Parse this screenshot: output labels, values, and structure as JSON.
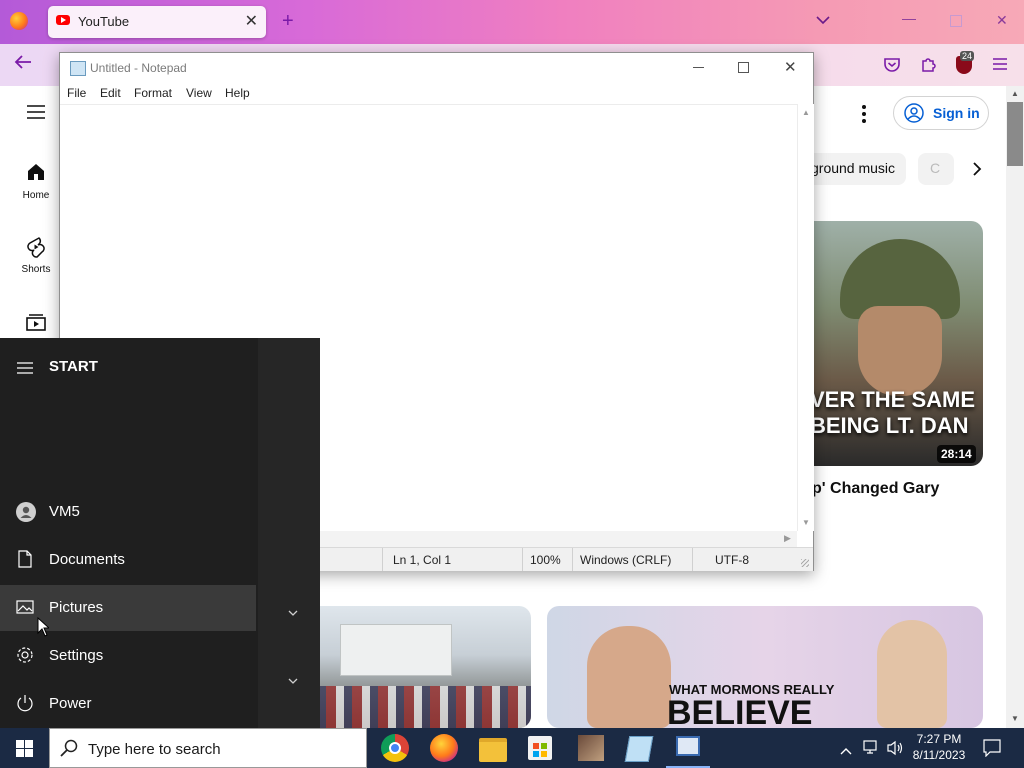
{
  "browser": {
    "tab_title": "YouTube",
    "tab_close": "✕",
    "new_tab": "+",
    "extension_badge": "24"
  },
  "youtube": {
    "guide": [
      {
        "label": "Home",
        "icon": "home-icon"
      },
      {
        "label": "Shorts",
        "icon": "shorts-icon"
      },
      {
        "label": "",
        "icon": "subscriptions-icon"
      }
    ],
    "sign_in": "Sign in",
    "chips": [
      "ground music",
      "C"
    ],
    "videos": [
      {
        "overlay_line1": "VER THE SAME",
        "overlay_line2": "BEING LT. DAN",
        "duration": "28:14",
        "title": "p' Changed Gary"
      },
      {
        "overlay_line1": "WHAT MORMONS REALLY",
        "overlay_line2": "BELIEVE"
      }
    ]
  },
  "notepad": {
    "title": "Untitled - Notepad",
    "menu": [
      "File",
      "Edit",
      "Format",
      "View",
      "Help"
    ],
    "content": "",
    "status": {
      "position": "Ln 1, Col 1",
      "zoom": "100%",
      "line_ending": "Windows (CRLF)",
      "encoding": "UTF-8"
    }
  },
  "start_menu": {
    "header": "START",
    "items": [
      {
        "label": "VM5",
        "icon": "user-icon"
      },
      {
        "label": "Documents",
        "icon": "document-icon"
      },
      {
        "label": "Pictures",
        "icon": "pictures-icon"
      },
      {
        "label": "Settings",
        "icon": "settings-icon"
      },
      {
        "label": "Power",
        "icon": "power-icon"
      }
    ]
  },
  "taskbar": {
    "search_placeholder": "Type here to search",
    "apps": [
      "chrome-icon",
      "firefox-icon",
      "file-explorer-icon",
      "store-icon",
      "photo-app-icon",
      "notepad-icon",
      "network-app-icon"
    ],
    "time": "7:27 PM",
    "date": "8/11/2023"
  },
  "colors": {
    "youtube_red": "#ff0000",
    "link_blue": "#065fd4",
    "start_bg": "#1f1f1f",
    "taskbar_bg": "#1b2a44",
    "firefox_accent": "#7a1aa8"
  }
}
